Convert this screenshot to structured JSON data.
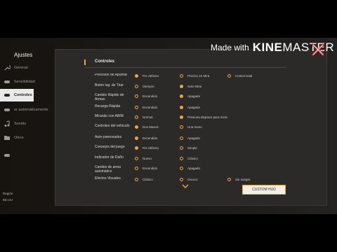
{
  "watermark": {
    "prefix": "Made with",
    "brand_bold": "KINE",
    "brand_light": "MASTER"
  },
  "sidebar": {
    "title": "Ajustes",
    "items": [
      {
        "label": "General",
        "icon": "wrench-icon"
      },
      {
        "label": "Sensibilidad",
        "icon": "gamepad-icon"
      },
      {
        "label": "Controles",
        "icon": "controller-icon",
        "active": true
      },
      {
        "label": "or automáticamente",
        "icon": "controller-icon"
      },
      {
        "label": "Sonido",
        "icon": "music-note-icon"
      },
      {
        "label": "Otros",
        "icon": "folder-icon"
      },
      {
        "label": "",
        "icon": "gamepad-icon"
      }
    ],
    "region_label": "Región",
    "region_value": "EE.UU"
  },
  "panel": {
    "section_title": "Controles",
    "custom_hud_label": "CUSTOM HUD",
    "accent_color": "#f0a43a",
    "rows": [
      {
        "name": "Precisión de Apuntar",
        "options": [
          {
            "text": "Por defecto",
            "selected": true
          },
          {
            "text": "Preciso en Mira",
            "selected": false
          },
          {
            "text": "Control total",
            "selected": false
          }
        ]
      },
      {
        "name": "Botón lug. de Tirar",
        "options": [
          {
            "text": "Siempre",
            "selected": false
          },
          {
            "text": "Solo Mirar",
            "selected": true
          }
        ]
      },
      {
        "name": "Cambio Rápido de Armas",
        "options": [
          {
            "text": "Encendido",
            "selected": false
          },
          {
            "text": "Apagado",
            "selected": true
          }
        ]
      },
      {
        "name": "Recarga Rápida",
        "options": [
          {
            "text": "Encendido",
            "selected": false
          },
          {
            "text": "Apagado",
            "selected": true
          }
        ]
      },
      {
        "name": "Mirando con AWM",
        "options": [
          {
            "text": "Normal",
            "selected": false
          },
          {
            "text": "Presiona disparar para mirar",
            "selected": true
          }
        ]
      },
      {
        "name": "Controles del vehículo",
        "options": [
          {
            "text": "Dos Manos",
            "selected": true
          },
          {
            "text": "Una mano",
            "selected": false
          }
        ]
      },
      {
        "name": "Auto-pareceados",
        "options": [
          {
            "text": "Encendido",
            "selected": true
          },
          {
            "text": "Apagado",
            "selected": false
          }
        ]
      },
      {
        "name": "Consejos del juego",
        "options": [
          {
            "text": "Por defecto",
            "selected": true
          },
          {
            "text": "Simple",
            "selected": false
          }
        ]
      },
      {
        "name": "Indicador de Daño",
        "options": [
          {
            "text": "Nuevo",
            "selected": false
          },
          {
            "text": "Clásico",
            "selected": false
          }
        ]
      },
      {
        "name": "Cambio de arma automático",
        "options": [
          {
            "text": "Encendido",
            "selected": false
          },
          {
            "text": "Apagado",
            "selected": false
          }
        ]
      },
      {
        "name": "Efectos Visuales",
        "options": [
          {
            "text": "Clásico",
            "selected": false
          },
          {
            "text": "Oscuro",
            "selected": false
          },
          {
            "text": "Sin sangre",
            "selected": false
          }
        ]
      }
    ]
  }
}
